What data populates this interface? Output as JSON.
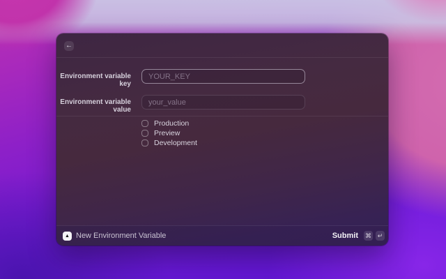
{
  "window": {
    "header": {
      "back_icon": "←"
    },
    "form": {
      "fields": [
        {
          "label": "Environment variable key",
          "placeholder": "YOUR_KEY",
          "value": "",
          "focused": true
        },
        {
          "label": "Environment variable value",
          "placeholder": "your_value",
          "value": "",
          "focused": false
        }
      ],
      "environments": [
        {
          "label": "Production",
          "checked": false
        },
        {
          "label": "Preview",
          "checked": false
        },
        {
          "label": "Development",
          "checked": false
        }
      ]
    },
    "footer": {
      "app_icon": "▲",
      "command_title": "New Environment Variable",
      "submit_label": "Submit",
      "shortcut_keys": [
        "⌘",
        "↵"
      ]
    }
  },
  "colors": {
    "window_background_top": "#3e2643",
    "window_background_bottom": "#332052",
    "focused_field_border": "#b5aabe",
    "wallpaper_magenta": "#c133ab",
    "wallpaper_lavender": "#c9c4e4",
    "wallpaper_pink": "#d36cb0",
    "wallpaper_violet": "#6818d4"
  }
}
